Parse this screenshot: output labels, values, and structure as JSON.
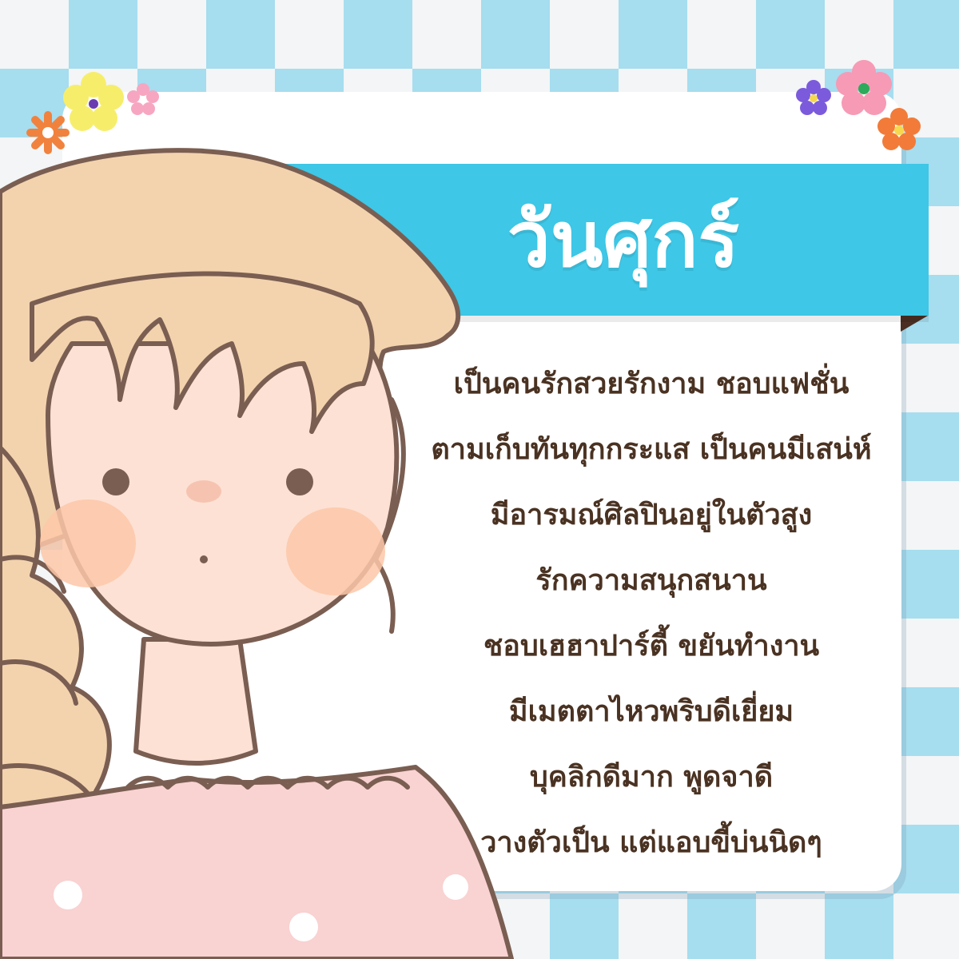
{
  "title": "วันศุกร์",
  "lines": [
    "เป็นคนรักสวยรักงาม ชอบแฟชั่น",
    "ตามเก็บทันทุกกระแส  เป็นคนมีเสน่ห์",
    "มีอารมณ์ศิลปินอยู่ในตัวสูง",
    "รักความสนุกสนาน",
    "ชอบเฮฮาปาร์ตี้ ขยันทำงาน",
    "มีเมตตาไหวพริบดีเยี่ยม",
    "บุคลิกดีมาก พูดจาดี",
    "วางตัวเป็น แต่แอบขี้บ่นนิดๆ"
  ],
  "colors": {
    "banner": "#3ec7e6",
    "checker_light": "#f3f5f6",
    "checker_blue": "#a6ddef",
    "text": "#4a3222",
    "hair": "#f3d3ae",
    "skin": "#fde1d4",
    "dress": "#f9d2d2"
  },
  "icons": [
    "flower-icon",
    "girl-illustration"
  ]
}
